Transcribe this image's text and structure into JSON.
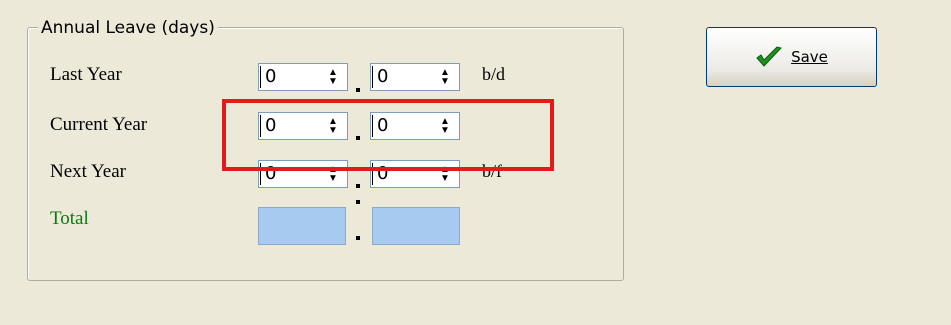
{
  "group": {
    "title": "Annual Leave (days)"
  },
  "rows": [
    {
      "label": "Last Year",
      "days": "0",
      "half": "0",
      "unit": "b/d"
    },
    {
      "label": "Current Year",
      "days": "0",
      "half": "0",
      "unit": ""
    },
    {
      "label": "Next Year",
      "days": "0",
      "half": "0",
      "unit": "b/f"
    }
  ],
  "total": {
    "label": "Total"
  },
  "save_button": {
    "label": "Save"
  },
  "colors": {
    "highlight": "#e31b1b",
    "total_label": "#0a7a0a",
    "readonly_fill": "#a6caf0"
  },
  "icons": {
    "save": "green-checkmark-icon",
    "spinner": "updown-arrows-icon"
  }
}
